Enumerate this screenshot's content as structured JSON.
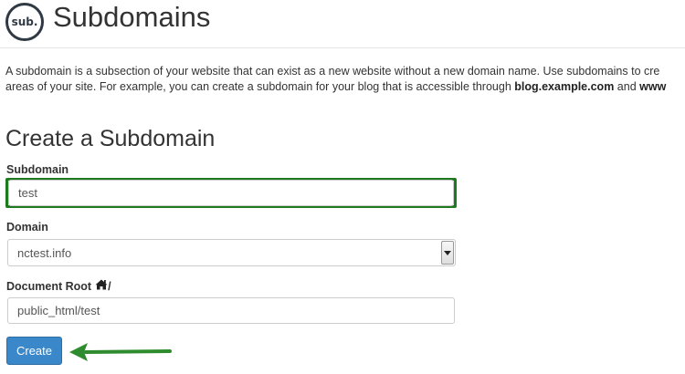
{
  "header": {
    "logo_text": "sub.",
    "title": "Subdomains"
  },
  "description": {
    "line1": "A subdomain is a subsection of your website that can exist as a new website without a new domain name. Use subdomains to cre",
    "line2_prefix": "areas of your site. For example, you can create a subdomain for your blog that is accessible through ",
    "line2_bold1": "blog.example.com",
    "line2_middle": " and ",
    "line2_bold2": "www"
  },
  "form": {
    "section_title": "Create a Subdomain",
    "subdomain_label": "Subdomain",
    "subdomain_value": "test",
    "domain_label": "Domain",
    "domain_selected": "nctest.info",
    "docroot_label": "Document Root",
    "docroot_suffix": "/",
    "docroot_value": "public_html/test",
    "create_button": "Create"
  },
  "colors": {
    "highlight": "#1f7a1f",
    "button": "#3a87c9",
    "arrow": "#2e8b2e"
  },
  "icons": {
    "home": "home-icon",
    "arrow": "annotation-arrow-icon"
  }
}
